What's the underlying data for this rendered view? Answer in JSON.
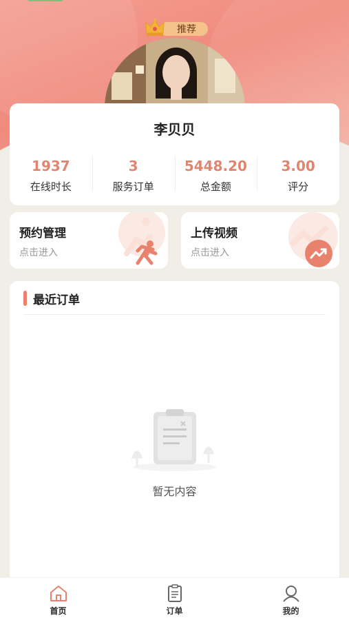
{
  "profile": {
    "badge_label": "推荐",
    "name": "李贝贝",
    "stats": [
      {
        "value": "1937",
        "label": "在线时长"
      },
      {
        "value": "3",
        "label": "服务订单"
      },
      {
        "value": "5448.20",
        "label": "总金额"
      },
      {
        "value": "3.00",
        "label": "评分"
      }
    ]
  },
  "quick_actions": [
    {
      "title": "预约管理",
      "subtitle": "点击进入",
      "icon": "running-person-icon"
    },
    {
      "title": "上传视频",
      "subtitle": "点击进入",
      "icon": "trend-up-icon"
    }
  ],
  "recent_orders": {
    "title": "最近订单",
    "empty_text": "暂无内容",
    "icon": "empty-clipboard-icon"
  },
  "tabbar": [
    {
      "label": "首页",
      "icon": "home-icon",
      "active": true
    },
    {
      "label": "订单",
      "icon": "clipboard-icon",
      "active": false
    },
    {
      "label": "我的",
      "icon": "user-icon",
      "active": false
    }
  ],
  "colors": {
    "accent": "#e0866f",
    "hero_gradient_start": "#f4a093",
    "hero_gradient_end": "#f4b4a6",
    "page_bg": "#f0eee6"
  }
}
